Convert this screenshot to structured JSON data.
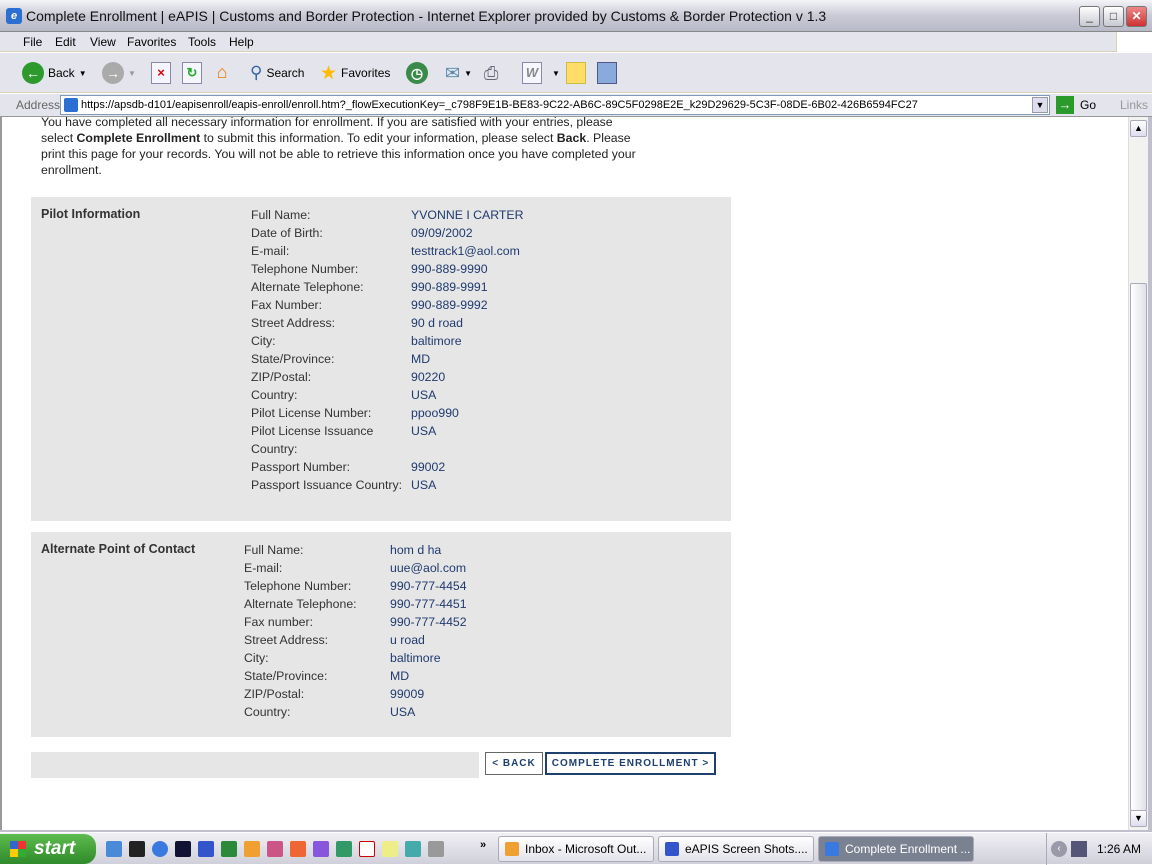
{
  "window": {
    "title": "Complete Enrollment | eAPIS | Customs and Border Protection - Internet Explorer provided by Customs & Border Protection v 1.3"
  },
  "menu": [
    "File",
    "Edit",
    "View",
    "Favorites",
    "Tools",
    "Help"
  ],
  "toolbar": {
    "back": "Back",
    "search": "Search",
    "favorites": "Favorites"
  },
  "address": {
    "label": "Address",
    "url": "https://apsdb-d101/eapisenroll/eapis-enroll/enroll.htm?_flowExecutionKey=_c798F9E1B-BE83-9C22-AB6C-89C5F0298E2E_k29D29629-5C3F-08DE-6B02-426B6594FC27",
    "go": "Go",
    "links": "Links"
  },
  "intro": {
    "line1": "You have completed all necessary information for enrollment. If you are satisfied with your entries, please select ",
    "bold1": "Complete Enrollment",
    "line2": " to submit this information. To edit your information, please select ",
    "bold2": "Back",
    "line3": ". Please print this page for your records. You will not be able to retrieve this information once you have completed your enrollment."
  },
  "pilot": {
    "heading": "Pilot Information",
    "fields": [
      {
        "k": "Full Name:",
        "v": "YVONNE I CARTER"
      },
      {
        "k": "Date of Birth:",
        "v": "09/09/2002"
      },
      {
        "k": "E-mail:",
        "v": "testtrack1@aol.com"
      },
      {
        "k": "Telephone Number:",
        "v": "990-889-9990"
      },
      {
        "k": "Alternate Telephone:",
        "v": "990-889-9991"
      },
      {
        "k": "Fax Number:",
        "v": "990-889-9992"
      },
      {
        "k": "Street Address:",
        "v": "90 d road"
      },
      {
        "k": "City:",
        "v": "baltimore"
      },
      {
        "k": "State/Province:",
        "v": "MD"
      },
      {
        "k": "ZIP/Postal:",
        "v": "90220"
      },
      {
        "k": "Country:",
        "v": "USA"
      },
      {
        "k": "Pilot License Number:",
        "v": "ppoo990"
      },
      {
        "k": "Pilot License Issuance Country:",
        "v": "USA"
      },
      {
        "k": "Passport Number:",
        "v": "99002"
      },
      {
        "k": "Passport Issuance Country:",
        "v": "USA"
      }
    ]
  },
  "contact": {
    "heading": "Alternate Point of Contact",
    "fields": [
      {
        "k": "Full Name:",
        "v": "hom d ha"
      },
      {
        "k": "E-mail:",
        "v": "uue@aol.com"
      },
      {
        "k": "Telephone Number:",
        "v": "990-777-4454"
      },
      {
        "k": "Alternate Telephone:",
        "v": "990-777-4451"
      },
      {
        "k": "Fax number:",
        "v": "990-777-4452"
      },
      {
        "k": "Street Address:",
        "v": "u road"
      },
      {
        "k": "City:",
        "v": "baltimore"
      },
      {
        "k": "State/Province:",
        "v": "MD"
      },
      {
        "k": "ZIP/Postal:",
        "v": "99009"
      },
      {
        "k": "Country:",
        "v": "USA"
      }
    ]
  },
  "buttons": {
    "back": "< BACK",
    "complete": "COMPLETE ENROLLMENT >"
  },
  "taskbar": {
    "start": "start",
    "tasks": [
      "Inbox - Microsoft Out...",
      "eAPIS Screen Shots....",
      "Complete Enrollment ..."
    ],
    "clock": "1:26 AM"
  }
}
